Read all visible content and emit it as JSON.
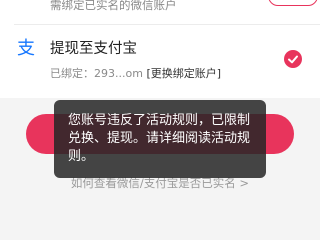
{
  "account_section": {
    "hint_top": "需绑定已实名的微信账户"
  },
  "alipay": {
    "title": "提现至支付宝",
    "bound_label": "已绑定：",
    "bound_account": "293...om",
    "change_link": "[更换绑定账户]",
    "selected": true
  },
  "help_link": "如何查看微信/支付宝是否已实名 >",
  "toast": {
    "message": "您账号违反了活动规则，已限制兑换、提现。请详细阅读活动规则。"
  },
  "colors": {
    "accent": "#e8345c",
    "alipay_blue": "#1677ff",
    "toast_bg": "#262626"
  }
}
